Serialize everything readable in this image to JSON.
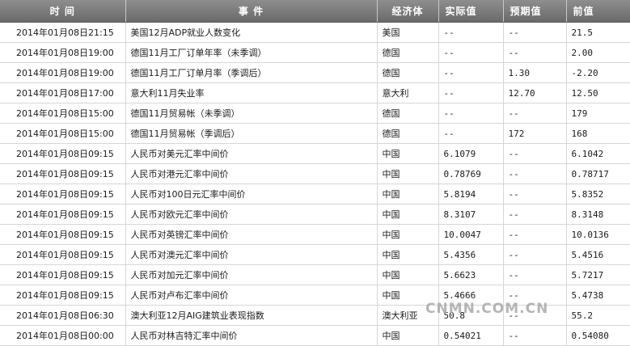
{
  "headers": {
    "time": "时 间",
    "event": "事 件",
    "country": "经济体",
    "actual": "实际值",
    "forecast": "预期值",
    "previous": "前值"
  },
  "rows": [
    {
      "time": "2014年01月08日21:15",
      "event": "美国12月ADP就业人数变化",
      "country": "美国",
      "actual": "--",
      "forecast": "--",
      "previous": "21.5"
    },
    {
      "time": "2014年01月08日19:00",
      "event": "德国11月工厂订单年率（未季调）",
      "country": "德国",
      "actual": "--",
      "forecast": "--",
      "previous": "2.00"
    },
    {
      "time": "2014年01月08日19:00",
      "event": "德国11月工厂订单月率（季调后）",
      "country": "德国",
      "actual": "--",
      "forecast": "1.30",
      "previous": "-2.20"
    },
    {
      "time": "2014年01月08日17:00",
      "event": "意大利11月失业率",
      "country": "意大利",
      "actual": "--",
      "forecast": "12.70",
      "previous": "12.50"
    },
    {
      "time": "2014年01月08日15:00",
      "event": "德国11月贸易帐（未季调）",
      "country": "德国",
      "actual": "--",
      "forecast": "--",
      "previous": "179"
    },
    {
      "time": "2014年01月08日15:00",
      "event": "德国11月贸易帐（季调后）",
      "country": "德国",
      "actual": "--",
      "forecast": "172",
      "previous": "168"
    },
    {
      "time": "2014年01月08日09:15",
      "event": "人民币对美元汇率中间价",
      "country": "中国",
      "actual": "6.1079",
      "forecast": "--",
      "previous": "6.1042"
    },
    {
      "time": "2014年01月08日09:15",
      "event": "人民币对港元汇率中间价",
      "country": "中国",
      "actual": "0.78769",
      "forecast": "--",
      "previous": "0.78717"
    },
    {
      "time": "2014年01月08日09:15",
      "event": "人民币对100日元汇率中间价",
      "country": "中国",
      "actual": "5.8194",
      "forecast": "--",
      "previous": "5.8352"
    },
    {
      "time": "2014年01月08日09:15",
      "event": "人民币对欧元汇率中间价",
      "country": "中国",
      "actual": "8.3107",
      "forecast": "--",
      "previous": "8.3148"
    },
    {
      "time": "2014年01月08日09:15",
      "event": "人民币对英镑汇率中间价",
      "country": "中国",
      "actual": "10.0047",
      "forecast": "--",
      "previous": "10.0136"
    },
    {
      "time": "2014年01月08日09:15",
      "event": "人民币对澳元汇率中间价",
      "country": "中国",
      "actual": "5.4356",
      "forecast": "--",
      "previous": "5.4516"
    },
    {
      "time": "2014年01月08日09:15",
      "event": "人民币对加元汇率中间价",
      "country": "中国",
      "actual": "5.6623",
      "forecast": "--",
      "previous": "5.7217"
    },
    {
      "time": "2014年01月08日09:15",
      "event": "人民币对卢布汇率中间价",
      "country": "中国",
      "actual": "5.4666",
      "forecast": "--",
      "previous": "5.4738"
    },
    {
      "time": "2014年01月08日06:30",
      "event": "澳大利亚12月AIG建筑业表现指数",
      "country": "澳大利亚",
      "actual": "50.8",
      "forecast": "--",
      "previous": "55.2"
    },
    {
      "time": "2014年01月08日00:00",
      "event": "人民币对林吉特汇率中间价",
      "country": "中国",
      "actual": "0.54021",
      "forecast": "--",
      "previous": "0.54080"
    }
  ],
  "watermark": "CNMN.COM.CN"
}
